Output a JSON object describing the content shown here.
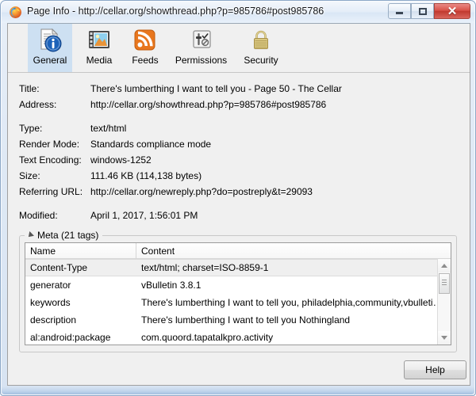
{
  "window": {
    "title": "Page Info - http://cellar.org/showthread.php?p=985786#post985786",
    "icon": "firefox-icon",
    "controls": {
      "minimize": "minimize-button",
      "maximize": "maximize-button",
      "close_glyph": "✕"
    }
  },
  "toolbar": {
    "tabs": [
      {
        "label": "General",
        "icon": "general-info-icon",
        "selected": true
      },
      {
        "label": "Media",
        "icon": "media-film-icon",
        "selected": false
      },
      {
        "label": "Feeds",
        "icon": "rss-feed-icon",
        "selected": false
      },
      {
        "label": "Permissions",
        "icon": "permissions-icon",
        "selected": false
      },
      {
        "label": "Security",
        "icon": "padlock-icon",
        "selected": false
      }
    ]
  },
  "general": {
    "fields": [
      {
        "label": "Title:",
        "value": "There's lumberthing I want to tell you - Page 50 - The Cellar"
      },
      {
        "label": "Address:",
        "value": "http://cellar.org/showthread.php?p=985786#post985786"
      },
      {
        "label": "Type:",
        "value": "text/html"
      },
      {
        "label": "Render Mode:",
        "value": "Standards compliance mode"
      },
      {
        "label": "Text Encoding:",
        "value": "windows-1252"
      },
      {
        "label": "Size:",
        "value": "111.46 KB (114,138 bytes)"
      },
      {
        "label": "Referring URL:",
        "value": "http://cellar.org/newreply.php?do=postreply&t=29093"
      },
      {
        "label": "Modified:",
        "value": "April 1, 2017, 1:56:01 PM"
      }
    ]
  },
  "meta": {
    "legend": "Meta (21 tags)",
    "columns": {
      "name": "Name",
      "content": "Content"
    },
    "rows": [
      {
        "name": "Content-Type",
        "content": "text/html; charset=ISO-8859-1",
        "selected": true
      },
      {
        "name": "generator",
        "content": "vBulletin 3.8.1",
        "selected": false
      },
      {
        "name": "keywords",
        "content": " There's lumberthing I want to tell you, philadelphia,community,vbulleti…",
        "selected": false
      },
      {
        "name": "description",
        "content": " There's lumberthing I want to tell you Nothingland",
        "selected": false
      },
      {
        "name": "al:android:package",
        "content": "com.quoord.tapatalkpro.activity",
        "selected": false
      }
    ]
  },
  "footer": {
    "help_label": "Help"
  },
  "colors": {
    "accent_selected_tab": "#cde0f2",
    "close_button": "#c0392f",
    "frame": "#8ba7c7",
    "panel": "#f0f0f0"
  }
}
